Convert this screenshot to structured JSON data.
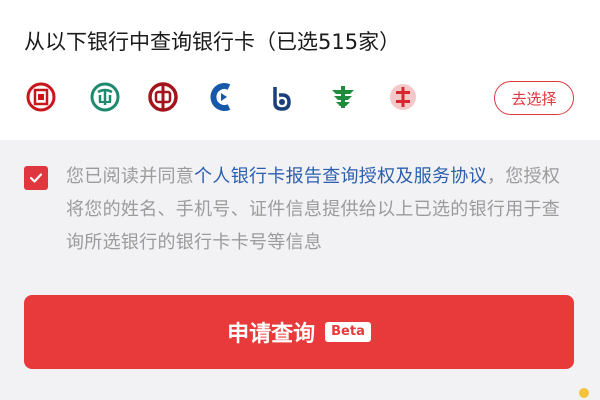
{
  "header": {
    "title": "从以下银行中查询银行卡（已选515家）",
    "select_button": "去选择"
  },
  "banks": [
    {
      "icon": "icbc-logo-icon",
      "color": "#c8161d"
    },
    {
      "icon": "abc-logo-icon",
      "color": "#1d8a6f"
    },
    {
      "icon": "boc-logo-icon",
      "color": "#a3141c"
    },
    {
      "icon": "ccb-logo-icon",
      "color": "#1758a8"
    },
    {
      "icon": "bocom-logo-icon",
      "color": "#1b3f7a"
    },
    {
      "icon": "psbc-logo-icon",
      "color": "#1e8c3a"
    },
    {
      "icon": "citic-logo-icon",
      "color": "#d7262d"
    }
  ],
  "agreement": {
    "checked": true,
    "prefix": "您已阅读并同意",
    "link": "个人银行卡报告查询授权及服务协议",
    "suffix": "，您授权将您的姓名、手机号、证件信息提供给以上已选的银行用于查询所选银行的银行卡卡号等信息"
  },
  "apply": {
    "label": "申请查询",
    "badge": "Beta"
  },
  "colors": {
    "accent": "#e0363d",
    "button": "#e83a3a",
    "link": "#2a5fb0"
  }
}
